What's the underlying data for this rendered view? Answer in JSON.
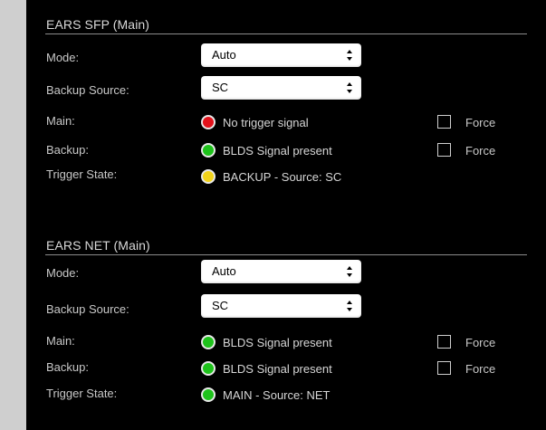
{
  "colors": {
    "led_red": "#e2121b",
    "led_green": "#1ec21b",
    "led_yellow": "#f2d31a",
    "panel_bg": "#000000"
  },
  "sections": [
    {
      "title": "EARS SFP (Main)",
      "mode_label": "Mode:",
      "mode_value": "Auto",
      "backup_source_label": "Backup Source:",
      "backup_source_value": "SC",
      "main_label": "Main:",
      "main_status": {
        "led": "red",
        "text": "No trigger signal"
      },
      "main_force_label": "Force",
      "backup_label": "Backup:",
      "backup_status": {
        "led": "green",
        "text": "BLDS Signal present"
      },
      "backup_force_label": "Force",
      "trigger_label": "Trigger State:",
      "trigger_status": {
        "led": "yellow",
        "text": "BACKUP - Source: SC"
      }
    },
    {
      "title": "EARS NET (Main)",
      "mode_label": "Mode:",
      "mode_value": "Auto",
      "backup_source_label": "Backup Source:",
      "backup_source_value": "SC",
      "main_label": "Main:",
      "main_status": {
        "led": "green",
        "text": "BLDS Signal present"
      },
      "main_force_label": "Force",
      "backup_label": "Backup:",
      "backup_status": {
        "led": "green",
        "text": "BLDS Signal present"
      },
      "backup_force_label": "Force",
      "trigger_label": "Trigger State:",
      "trigger_status": {
        "led": "green",
        "text": "MAIN - Source: NET"
      }
    }
  ]
}
